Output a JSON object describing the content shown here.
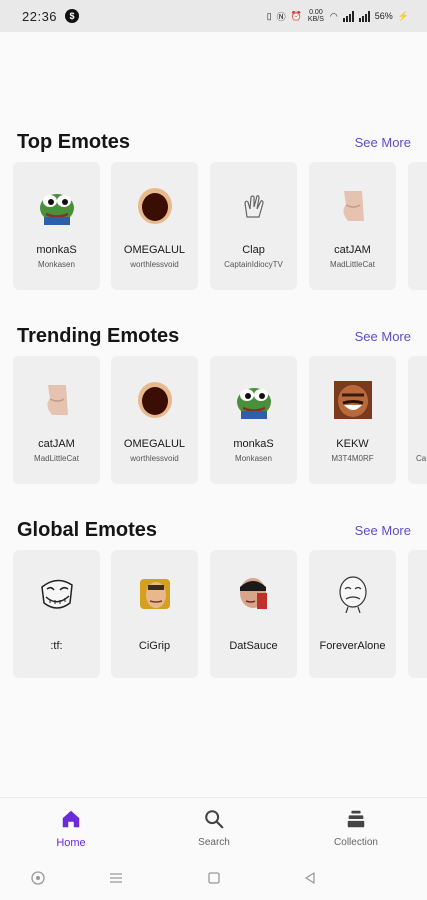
{
  "status": {
    "time": "22:36",
    "app_badge": "$",
    "speed": "0.00 KB/S",
    "battery": "56%"
  },
  "sections": [
    {
      "title": "Top Emotes",
      "see_more": "See More",
      "cards": [
        {
          "name": "monkaS",
          "author": "Monkasen",
          "icon": "pepe-frog-icon"
        },
        {
          "name": "OMEGALUL",
          "author": "worthlessvoid",
          "icon": "omegalul-face-icon"
        },
        {
          "name": "Clap",
          "author": "CaptainIdiocyTV",
          "icon": "clapping-hand-icon"
        },
        {
          "name": "catJAM",
          "author": "MadLittleCat",
          "icon": "cat-jam-icon"
        }
      ]
    },
    {
      "title": "Trending Emotes",
      "see_more": "See More",
      "cards": [
        {
          "name": "catJAM",
          "author": "MadLittleCat",
          "icon": "cat-jam-icon"
        },
        {
          "name": "OMEGALUL",
          "author": "worthlessvoid",
          "icon": "omegalul-face-icon"
        },
        {
          "name": "monkaS",
          "author": "Monkasen",
          "icon": "pepe-frog-icon"
        },
        {
          "name": "KEKW",
          "author": "M3T4M0RF",
          "icon": "kekw-laughing-face-icon"
        },
        {
          "name": "",
          "author": "Ca",
          "icon": ""
        }
      ]
    },
    {
      "title": "Global Emotes",
      "see_more": "See More",
      "cards": [
        {
          "name": ":tf:",
          "author": "",
          "icon": "trollface-icon"
        },
        {
          "name": "CiGrip",
          "author": "",
          "icon": "cigrip-face-icon"
        },
        {
          "name": "DatSauce",
          "author": "",
          "icon": "datsauce-face-icon"
        },
        {
          "name": "ForeverAlone",
          "author": "",
          "icon": "forever-alone-face-icon"
        }
      ]
    }
  ],
  "nav": {
    "home": "Home",
    "search": "Search",
    "collection": "Collection"
  },
  "colors": {
    "accent": "#6c2bd9",
    "see_more": "#5b4fc8",
    "card_bg": "#efefef"
  }
}
